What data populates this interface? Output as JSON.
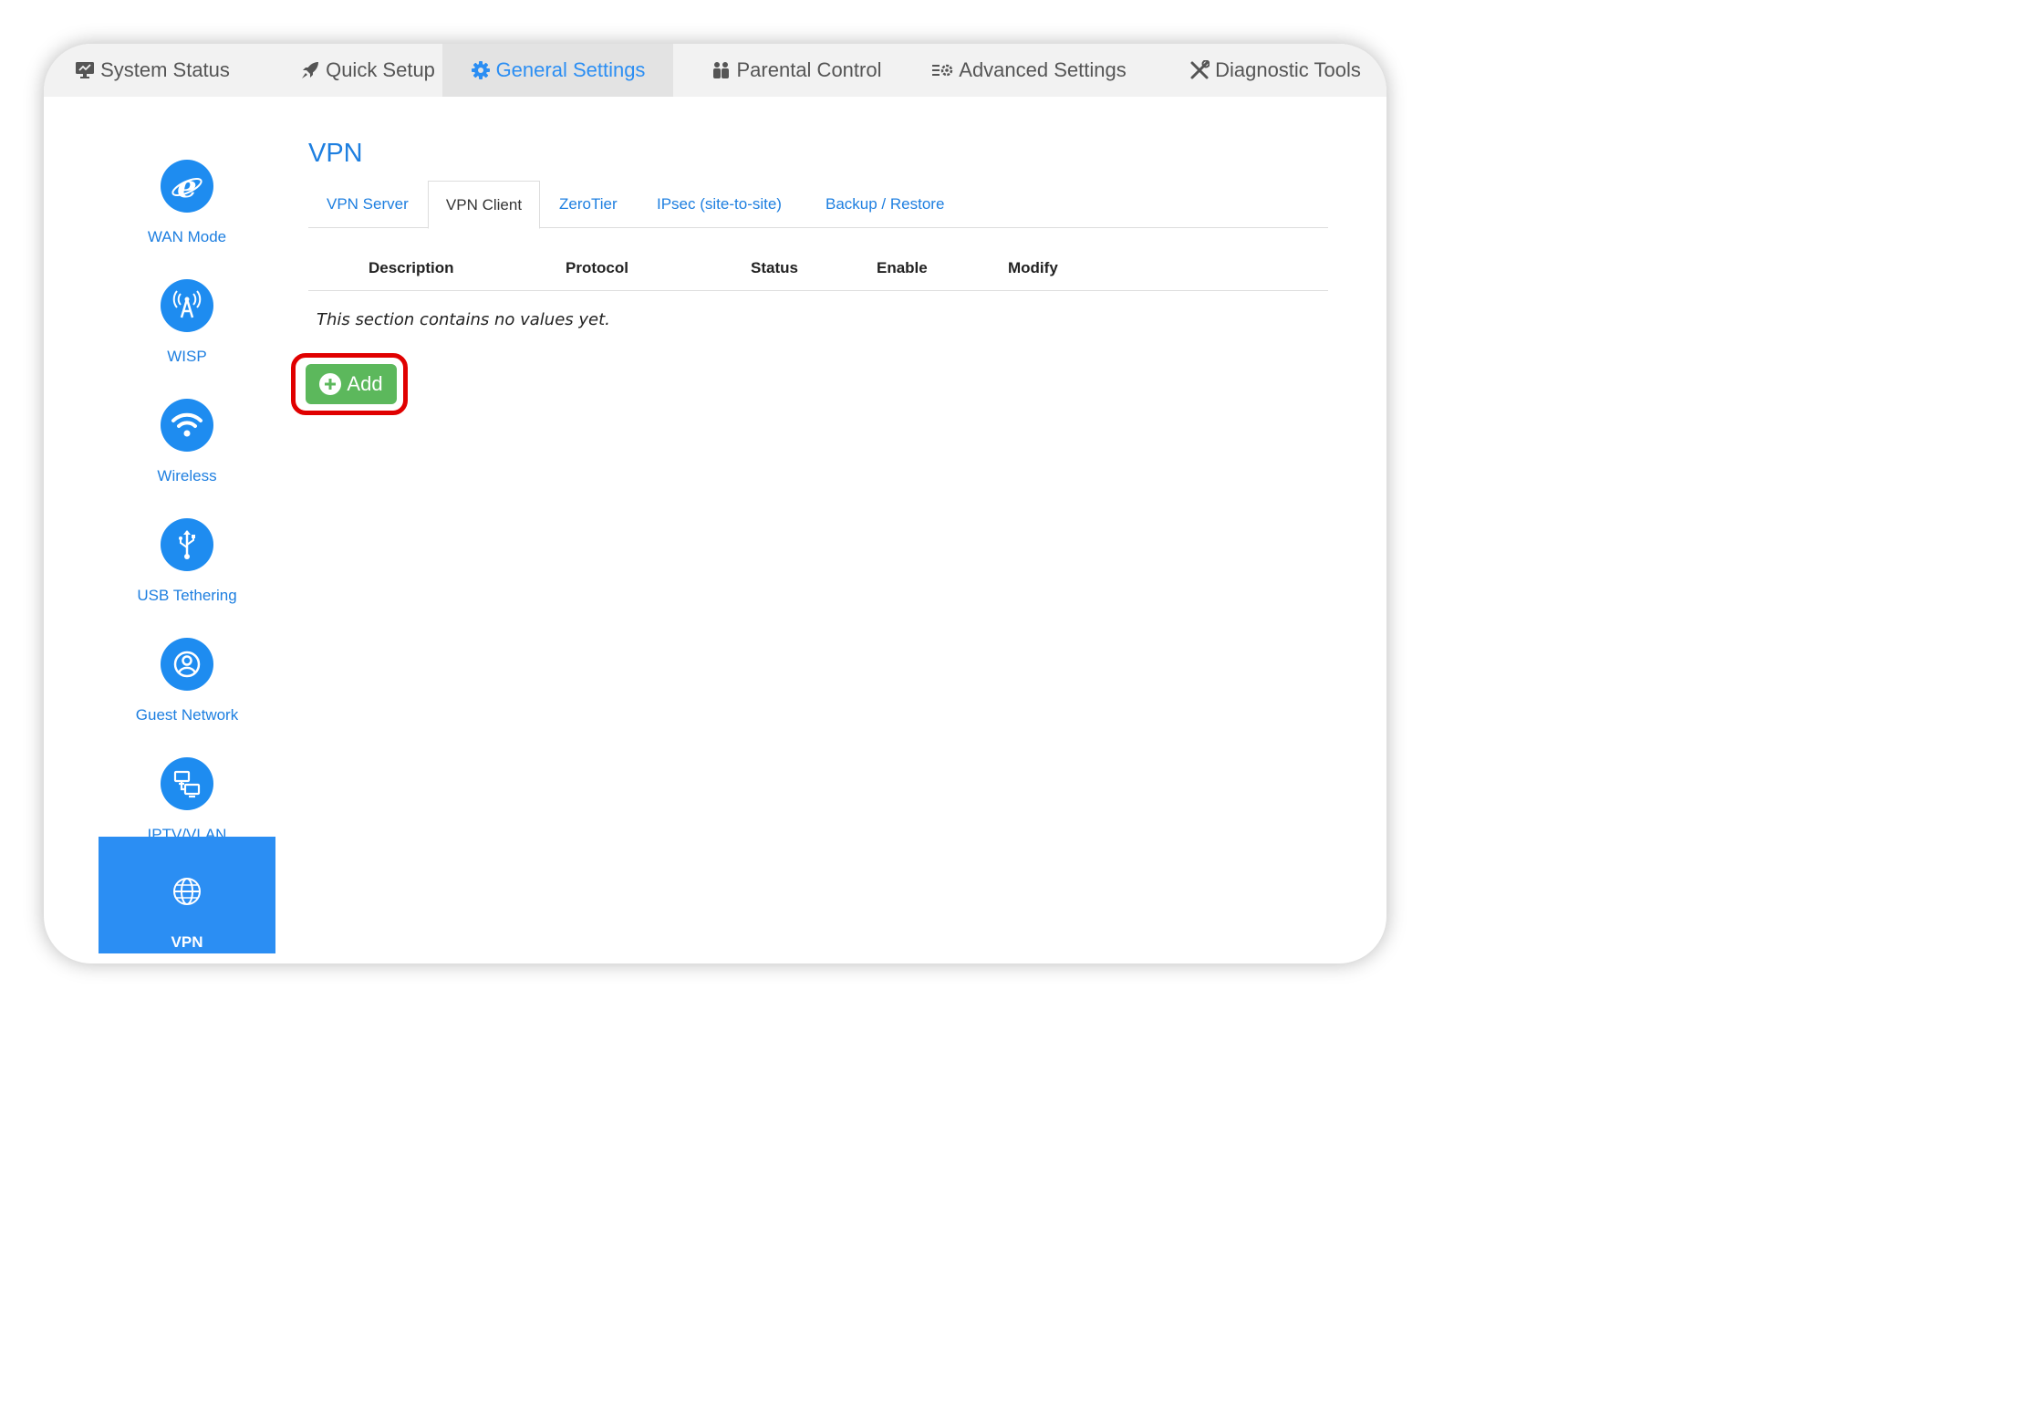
{
  "colors": {
    "accent": "#1e8cf0",
    "active_tab_text": "#2b8ef3",
    "add_button": "#5cb85c",
    "highlight": "#e00000"
  },
  "topnav": {
    "items": [
      {
        "label": "System Status",
        "icon": "monitor-icon"
      },
      {
        "label": "Quick Setup",
        "icon": "rocket-icon"
      },
      {
        "label": "General Settings",
        "icon": "gear-icon",
        "active": true
      },
      {
        "label": "Parental Control",
        "icon": "family-icon"
      },
      {
        "label": "Advanced Settings",
        "icon": "advanced-settings-icon"
      },
      {
        "label": "Diagnostic Tools",
        "icon": "tools-icon"
      }
    ]
  },
  "sidebar": {
    "items": [
      {
        "label": "WAN Mode",
        "icon": "internet-explorer-icon"
      },
      {
        "label": "WISP",
        "icon": "antenna-icon"
      },
      {
        "label": "Wireless",
        "icon": "wifi-icon"
      },
      {
        "label": "USB Tethering",
        "icon": "usb-icon"
      },
      {
        "label": "Guest Network",
        "icon": "guest-user-icon"
      },
      {
        "label": "IPTV/VLAN",
        "icon": "network-icon"
      },
      {
        "label": "VPN",
        "icon": "globe-icon",
        "active": true
      }
    ]
  },
  "main": {
    "title": "VPN",
    "tabs": [
      {
        "label": "VPN Server"
      },
      {
        "label": "VPN Client",
        "active": true
      },
      {
        "label": "ZeroTier"
      },
      {
        "label": "IPsec (site-to-site)"
      },
      {
        "label": "Backup / Restore"
      }
    ],
    "table": {
      "columns": [
        "Description",
        "Protocol",
        "Status",
        "Enable",
        "Modify"
      ]
    },
    "empty_message": "This section contains no values yet.",
    "add_label": "Add"
  }
}
